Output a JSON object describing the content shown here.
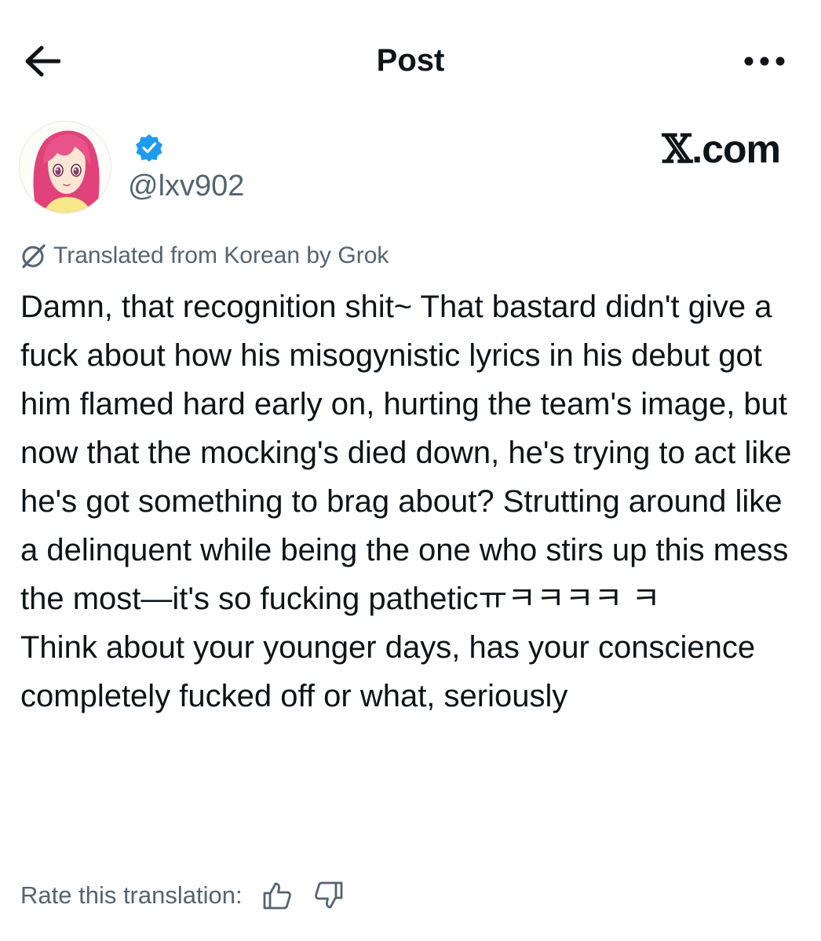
{
  "header": {
    "title": "Post"
  },
  "author": {
    "handle": "@lxv902",
    "verified": true,
    "accent_color": "#1d9bf0"
  },
  "site_mark": {
    "letter": "𝕏",
    "suffix": ".com"
  },
  "translation": {
    "notice": "Translated from Korean by Grok",
    "paragraph_1": "Damn, that recognition shit~ That bastard didn't give a fuck about how his misogynistic lyrics in his debut got him flamed hard early on, hurting the team's image, but now that the mocking's died down, he's trying to act like he's got something to brag about? Strutting around like a delinquent while being the one who stirs up this mess the most—it's so fucking patheticㅠㅋㅋㅋㅋ ㅋ",
    "paragraph_2": "Think about your younger days, has your conscience completely fucked off or what, seriously",
    "rate_label": "Rate this translation:"
  },
  "icons": {
    "back": "arrow-left-icon",
    "more": "more-dots-icon",
    "verified": "verified-badge-icon",
    "grok": "grok-icon",
    "thumbs_up": "thumbs-up-icon",
    "thumbs_down": "thumbs-down-icon"
  }
}
